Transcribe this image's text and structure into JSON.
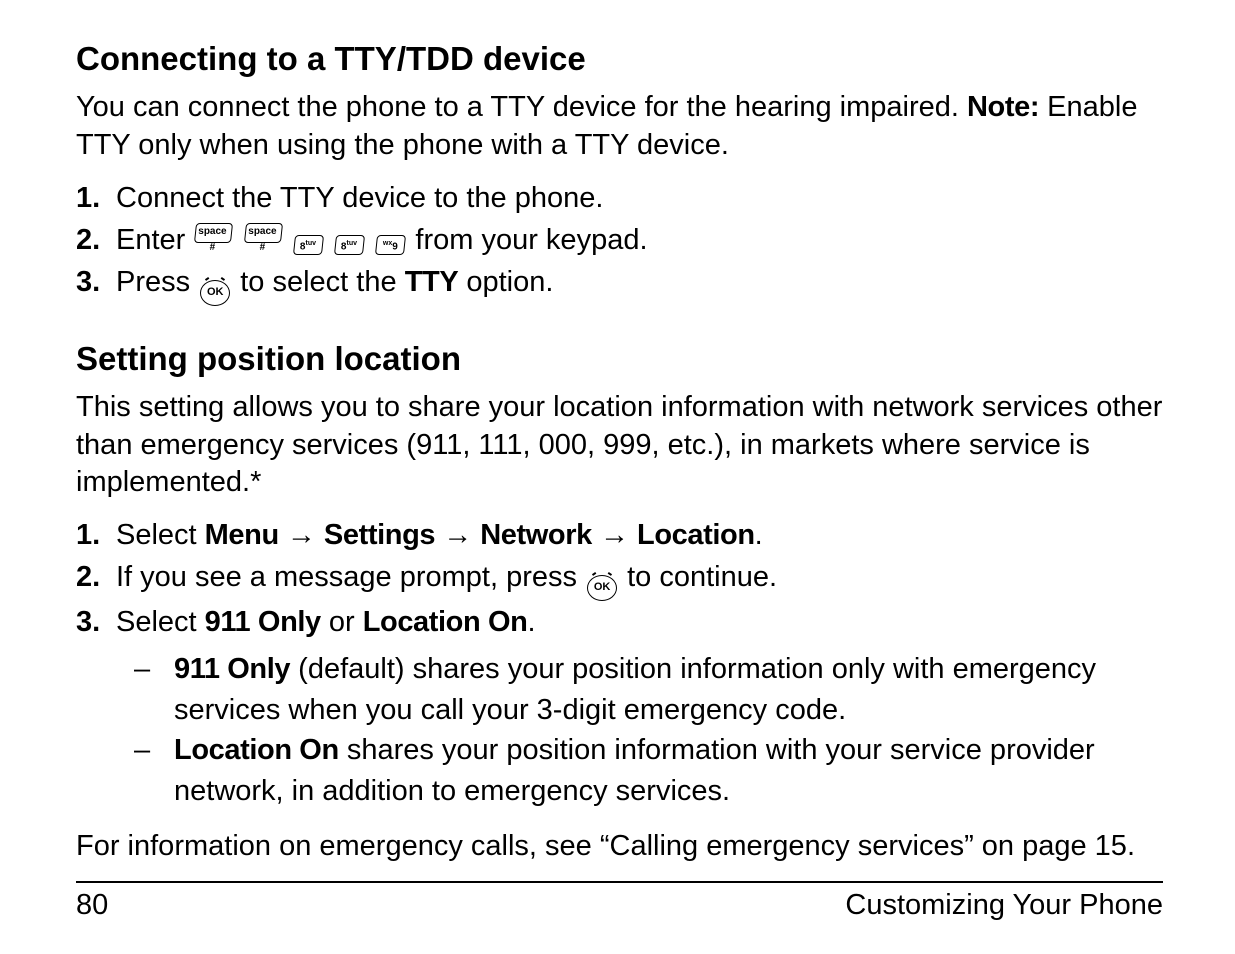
{
  "sec1": {
    "heading": "Connecting to a TTY/TDD device",
    "intro_a": "You can connect the phone to a TTY device for the hearing impaired. ",
    "intro_note_label": "Note:",
    "intro_b": " Enable TTY only when using the phone with a TTY device.",
    "step1": "Connect the TTY device to the phone.",
    "step2_a": "Enter ",
    "step2_b": " from your keypad.",
    "step3_a": "Press ",
    "step3_b": " to select the ",
    "step3_tty": "TTY",
    "step3_c": " option.",
    "keypad_keys": [
      "#",
      "#",
      "8",
      "8",
      "9"
    ],
    "key_labels": {
      "#": "space\n#",
      "8": "8tuv",
      "9": "wx9\nyz"
    }
  },
  "sec2": {
    "heading": "Setting position location",
    "intro": "This setting allows you to share your location information with network services other than emergency services (911, 111, 000, 999, etc.), in markets where service is implemented.*",
    "step1_a": "Select ",
    "step1_menu": "Menu",
    "step1_settings": "Settings",
    "step1_network": "Network",
    "step1_location": "Location",
    "step1_end": ".",
    "step2_a": "If you see a message prompt, press ",
    "step2_b": " to continue.",
    "step3_a": "Select ",
    "step3_opt1": "911 Only",
    "step3_or": " or ",
    "step3_opt2": "Location On",
    "step3_end": ".",
    "sub1_label": "911 Only",
    "sub1_rest": " (default) shares your position information only with emergency services when you call your 3-digit emergency code.",
    "sub2_label": "Location On",
    "sub2_rest": " shares your position information with your service provider network, in addition to emergency services.",
    "closing": "For information on emergency calls, see “Calling emergency services” on page 15."
  },
  "footer": {
    "page": "80",
    "section": "Customizing Your Phone"
  },
  "arrow": "→",
  "ok_label": "OK"
}
